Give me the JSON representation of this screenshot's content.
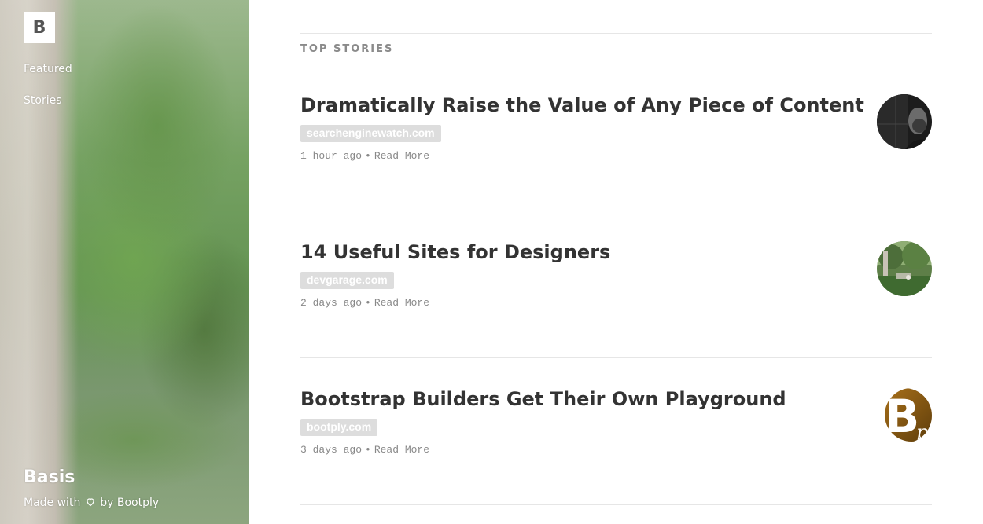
{
  "sidebar": {
    "logo_letter": "B",
    "nav": [
      {
        "label": "Featured"
      },
      {
        "label": "Stories"
      }
    ],
    "brand": "Basis",
    "footer": {
      "made_with": "Made with",
      "heart_icon": "heart-icon",
      "by": "by Bootply"
    }
  },
  "main": {
    "section_title": "TOP STORIES",
    "stories": [
      {
        "title": "Dramatically Raise the Value of Any Piece of Content",
        "source": "searchenginewatch.com",
        "time": "1 hour ago",
        "separator": "•",
        "read_more": "Read More",
        "avatar": "portrait-photo"
      },
      {
        "title": "14 Useful Sites for Designers",
        "source": "devgarage.com",
        "time": "2 days ago",
        "separator": "•",
        "read_more": "Read More",
        "avatar": "park-photo"
      },
      {
        "title": "Bootstrap Builders Get Their Own Playground",
        "source": "bootply.com",
        "time": "3 days ago",
        "separator": "•",
        "read_more": "Read More",
        "avatar": "bootply-logo"
      }
    ]
  },
  "colors": {
    "title_text": "#333333",
    "muted_text": "#888888",
    "tag_bg": "#dddddd",
    "divider": "#e6e6e6"
  }
}
